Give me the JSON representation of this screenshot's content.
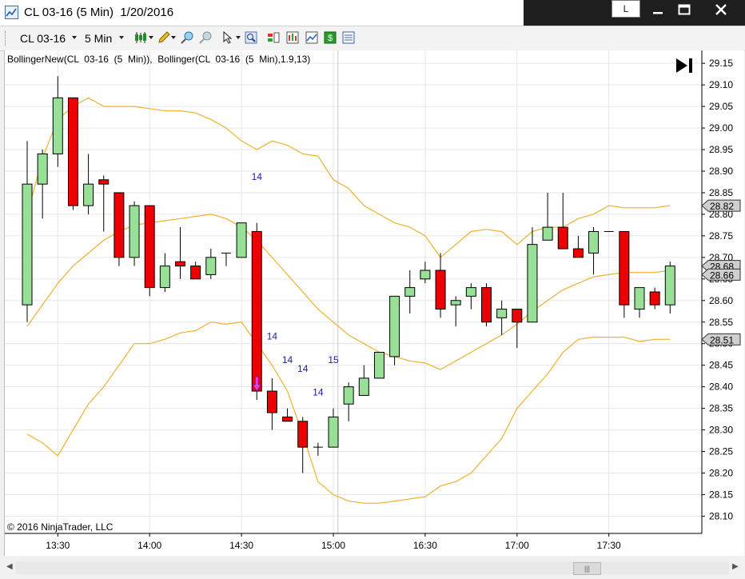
{
  "window": {
    "title": "CL 03-16 (5 Min)  1/20/2016",
    "layout_button_label": "L",
    "min_icon": "minimize-icon",
    "max_icon": "maximize-icon",
    "close_icon": "close-icon"
  },
  "toolbar": {
    "instrument": "CL 03-16",
    "interval": "5 Min",
    "icons": [
      "candlestick-style-icon",
      "drawing-pencil-icon",
      "zoom-in-icon",
      "zoom-out-icon",
      "cursor-select-icon",
      "magnifier-icon",
      "data-box-icon",
      "chart-properties-icon",
      "indicators-icon",
      "strategies-icon",
      "properties-icon"
    ]
  },
  "chart_data": {
    "type": "candlestick",
    "indicator_label": "BollingerNew(CL  03-16  (5  Min)),  Bollinger(CL  03-16  (5  Min),1.9,13)",
    "copyright": "© 2016 NinjaTrader, LLC",
    "colors": {
      "up": "#98e098",
      "down": "#ee0000",
      "band": "#f0b030",
      "grid": "#e6e6e6"
    },
    "ylim": [
      28.06,
      29.18
    ],
    "y_ticks": [
      "29.15",
      "29.10",
      "29.05",
      "29.00",
      "28.95",
      "28.90",
      "28.85",
      "28.80",
      "28.75",
      "28.70",
      "28.65",
      "28.60",
      "28.55",
      "28.50",
      "28.45",
      "28.40",
      "28.35",
      "28.30",
      "28.25",
      "28.20",
      "28.15",
      "28.10"
    ],
    "x_ticks": [
      {
        "i": 2,
        "label": "13:30"
      },
      {
        "i": 8,
        "label": "14:00"
      },
      {
        "i": 14,
        "label": "14:30"
      },
      {
        "i": 20,
        "label": "15:00"
      },
      {
        "i": 26,
        "label": "16:30"
      },
      {
        "i": 32,
        "label": "17:00"
      },
      {
        "i": 38,
        "label": "17:30"
      }
    ],
    "candles": [
      {
        "o": 28.59,
        "h": 28.97,
        "l": 28.55,
        "c": 28.87
      },
      {
        "o": 28.87,
        "h": 28.95,
        "l": 28.79,
        "c": 28.94
      },
      {
        "o": 28.94,
        "h": 29.12,
        "l": 28.91,
        "c": 29.07
      },
      {
        "o": 29.07,
        "h": 29.07,
        "l": 28.81,
        "c": 28.82
      },
      {
        "o": 28.82,
        "h": 28.94,
        "l": 28.8,
        "c": 28.87
      },
      {
        "o": 28.88,
        "h": 28.89,
        "l": 28.76,
        "c": 28.87
      },
      {
        "o": 28.85,
        "h": 28.85,
        "l": 28.68,
        "c": 28.7
      },
      {
        "o": 28.7,
        "h": 28.83,
        "l": 28.68,
        "c": 28.82
      },
      {
        "o": 28.82,
        "h": 28.82,
        "l": 28.61,
        "c": 28.63
      },
      {
        "o": 28.63,
        "h": 28.71,
        "l": 28.62,
        "c": 28.68
      },
      {
        "o": 28.69,
        "h": 28.77,
        "l": 28.65,
        "c": 28.68
      },
      {
        "o": 28.68,
        "h": 28.69,
        "l": 28.65,
        "c": 28.65
      },
      {
        "o": 28.66,
        "h": 28.72,
        "l": 28.65,
        "c": 28.7
      },
      {
        "o": 28.71,
        "h": 28.71,
        "l": 28.68,
        "c": 28.71
      },
      {
        "o": 28.7,
        "h": 28.78,
        "l": 28.7,
        "c": 28.78
      },
      {
        "o": 28.76,
        "h": 28.78,
        "l": 28.37,
        "c": 28.39
      },
      {
        "o": 28.39,
        "h": 28.42,
        "l": 28.3,
        "c": 28.34
      },
      {
        "o": 28.33,
        "h": 28.35,
        "l": 28.32,
        "c": 28.32
      },
      {
        "o": 28.32,
        "h": 28.33,
        "l": 28.2,
        "c": 28.26
      },
      {
        "o": 28.26,
        "h": 28.27,
        "l": 28.24,
        "c": 28.26
      },
      {
        "o": 28.26,
        "h": 28.35,
        "l": 28.26,
        "c": 28.33
      },
      {
        "o": 28.36,
        "h": 28.41,
        "l": 28.32,
        "c": 28.4
      },
      {
        "o": 28.38,
        "h": 28.45,
        "l": 28.38,
        "c": 28.42
      },
      {
        "o": 28.42,
        "h": 28.48,
        "l": 28.42,
        "c": 28.48
      },
      {
        "o": 28.47,
        "h": 28.61,
        "l": 28.45,
        "c": 28.61
      },
      {
        "o": 28.61,
        "h": 28.67,
        "l": 28.57,
        "c": 28.63
      },
      {
        "o": 28.65,
        "h": 28.69,
        "l": 28.64,
        "c": 28.67
      },
      {
        "o": 28.67,
        "h": 28.71,
        "l": 28.56,
        "c": 28.58
      },
      {
        "o": 28.59,
        "h": 28.61,
        "l": 28.54,
        "c": 28.6
      },
      {
        "o": 28.61,
        "h": 28.64,
        "l": 28.58,
        "c": 28.63
      },
      {
        "o": 28.63,
        "h": 28.64,
        "l": 28.54,
        "c": 28.55
      },
      {
        "o": 28.56,
        "h": 28.6,
        "l": 28.52,
        "c": 28.58
      },
      {
        "o": 28.58,
        "h": 28.58,
        "l": 28.49,
        "c": 28.55
      },
      {
        "o": 28.55,
        "h": 28.77,
        "l": 28.55,
        "c": 28.73
      },
      {
        "o": 28.74,
        "h": 28.85,
        "l": 28.74,
        "c": 28.77
      },
      {
        "o": 28.77,
        "h": 28.85,
        "l": 28.72,
        "c": 28.72
      },
      {
        "o": 28.72,
        "h": 28.75,
        "l": 28.7,
        "c": 28.7
      },
      {
        "o": 28.71,
        "h": 28.77,
        "l": 28.66,
        "c": 28.76
      },
      {
        "o": 28.76,
        "h": 28.76,
        "l": 28.76,
        "c": 28.76
      },
      {
        "o": 28.76,
        "h": 28.76,
        "l": 28.56,
        "c": 28.59
      },
      {
        "o": 28.58,
        "h": 28.63,
        "l": 28.56,
        "c": 28.63
      },
      {
        "o": 28.62,
        "h": 28.63,
        "l": 28.58,
        "c": 28.59
      },
      {
        "o": 28.59,
        "h": 28.69,
        "l": 28.57,
        "c": 28.68
      }
    ],
    "upper_band": [
      [
        0,
        28.8
      ],
      [
        1,
        28.93
      ],
      [
        2,
        29.02
      ],
      [
        3,
        29.05
      ],
      [
        4,
        29.07
      ],
      [
        5,
        29.05
      ],
      [
        6,
        29.05
      ],
      [
        7,
        29.05
      ],
      [
        8,
        29.045
      ],
      [
        9,
        29.04
      ],
      [
        10,
        29.04
      ],
      [
        11,
        29.035
      ],
      [
        12,
        29.02
      ],
      [
        13,
        29.0
      ],
      [
        14,
        28.97
      ],
      [
        15,
        28.95
      ],
      [
        16,
        28.97
      ],
      [
        17,
        28.96
      ],
      [
        18,
        28.94
      ],
      [
        19,
        28.935
      ],
      [
        20,
        28.88
      ],
      [
        21,
        28.86
      ],
      [
        22,
        28.82
      ],
      [
        23,
        28.8
      ],
      [
        24,
        28.78
      ],
      [
        25,
        28.77
      ],
      [
        26,
        28.75
      ],
      [
        27,
        28.7
      ],
      [
        28,
        28.73
      ],
      [
        29,
        28.76
      ],
      [
        30,
        28.765
      ],
      [
        31,
        28.76
      ],
      [
        32,
        28.73
      ],
      [
        33,
        28.76
      ],
      [
        34,
        28.77
      ],
      [
        35,
        28.77
      ],
      [
        36,
        28.79
      ],
      [
        37,
        28.8
      ],
      [
        38,
        28.82
      ],
      [
        39,
        28.815
      ],
      [
        40,
        28.815
      ],
      [
        41,
        28.815
      ],
      [
        42,
        28.82
      ]
    ],
    "middle_band": [
      [
        0,
        28.54
      ],
      [
        1,
        28.59
      ],
      [
        2,
        28.64
      ],
      [
        3,
        28.68
      ],
      [
        4,
        28.71
      ],
      [
        5,
        28.74
      ],
      [
        6,
        28.76
      ],
      [
        7,
        28.775
      ],
      [
        8,
        28.78
      ],
      [
        9,
        28.785
      ],
      [
        10,
        28.79
      ],
      [
        11,
        28.795
      ],
      [
        12,
        28.8
      ],
      [
        13,
        28.79
      ],
      [
        14,
        28.77
      ],
      [
        15,
        28.74
      ],
      [
        16,
        28.7
      ],
      [
        17,
        28.66
      ],
      [
        18,
        28.62
      ],
      [
        19,
        28.58
      ],
      [
        20,
        28.55
      ],
      [
        21,
        28.52
      ],
      [
        22,
        28.5
      ],
      [
        23,
        28.48
      ],
      [
        24,
        28.47
      ],
      [
        25,
        28.46
      ],
      [
        26,
        28.455
      ],
      [
        27,
        28.44
      ],
      [
        28,
        28.46
      ],
      [
        29,
        28.48
      ],
      [
        30,
        28.5
      ],
      [
        31,
        28.52
      ],
      [
        32,
        28.545
      ],
      [
        33,
        28.575
      ],
      [
        34,
        28.6
      ],
      [
        35,
        28.625
      ],
      [
        36,
        28.64
      ],
      [
        37,
        28.655
      ],
      [
        38,
        28.66
      ],
      [
        39,
        28.665
      ],
      [
        40,
        28.665
      ],
      [
        41,
        28.665
      ],
      [
        42,
        28.67
      ]
    ],
    "lower_band": [
      [
        0,
        28.29
      ],
      [
        1,
        28.27
      ],
      [
        2,
        28.24
      ],
      [
        3,
        28.3
      ],
      [
        4,
        28.36
      ],
      [
        5,
        28.4
      ],
      [
        6,
        28.45
      ],
      [
        7,
        28.5
      ],
      [
        8,
        28.5
      ],
      [
        9,
        28.51
      ],
      [
        10,
        28.525
      ],
      [
        11,
        28.53
      ],
      [
        12,
        28.55
      ],
      [
        13,
        28.545
      ],
      [
        14,
        28.55
      ],
      [
        15,
        28.5
      ],
      [
        16,
        28.45
      ],
      [
        17,
        28.39
      ],
      [
        18,
        28.29
      ],
      [
        19,
        28.18
      ],
      [
        20,
        28.15
      ],
      [
        21,
        28.135
      ],
      [
        22,
        28.13
      ],
      [
        23,
        28.13
      ],
      [
        24,
        28.135
      ],
      [
        25,
        28.14
      ],
      [
        26,
        28.145
      ],
      [
        27,
        28.17
      ],
      [
        28,
        28.18
      ],
      [
        29,
        28.2
      ],
      [
        30,
        28.24
      ],
      [
        31,
        28.28
      ],
      [
        32,
        28.35
      ],
      [
        33,
        28.39
      ],
      [
        34,
        28.43
      ],
      [
        35,
        28.48
      ],
      [
        36,
        28.51
      ],
      [
        37,
        28.515
      ],
      [
        38,
        28.515
      ],
      [
        39,
        28.515
      ],
      [
        40,
        28.505
      ],
      [
        41,
        28.51
      ],
      [
        42,
        28.51
      ]
    ],
    "annotations": [
      {
        "i": 15,
        "y": 28.88,
        "text": "14"
      },
      {
        "i": 16,
        "y": 28.51,
        "text": "14"
      },
      {
        "i": 17,
        "y": 28.455,
        "text": "14"
      },
      {
        "i": 18,
        "y": 28.435,
        "text": "14"
      },
      {
        "i": 20,
        "y": 28.455,
        "text": "15"
      },
      {
        "i": 19,
        "y": 28.38,
        "text": "14"
      }
    ],
    "signal_arrow": {
      "i": 15,
      "y": 28.39
    },
    "price_markers": [
      {
        "y": 28.82,
        "label": "28.82"
      },
      {
        "y": 28.68,
        "label": "28.68"
      },
      {
        "y": 28.66,
        "label": "28.66"
      },
      {
        "y": 28.51,
        "label": "28.51"
      }
    ]
  }
}
